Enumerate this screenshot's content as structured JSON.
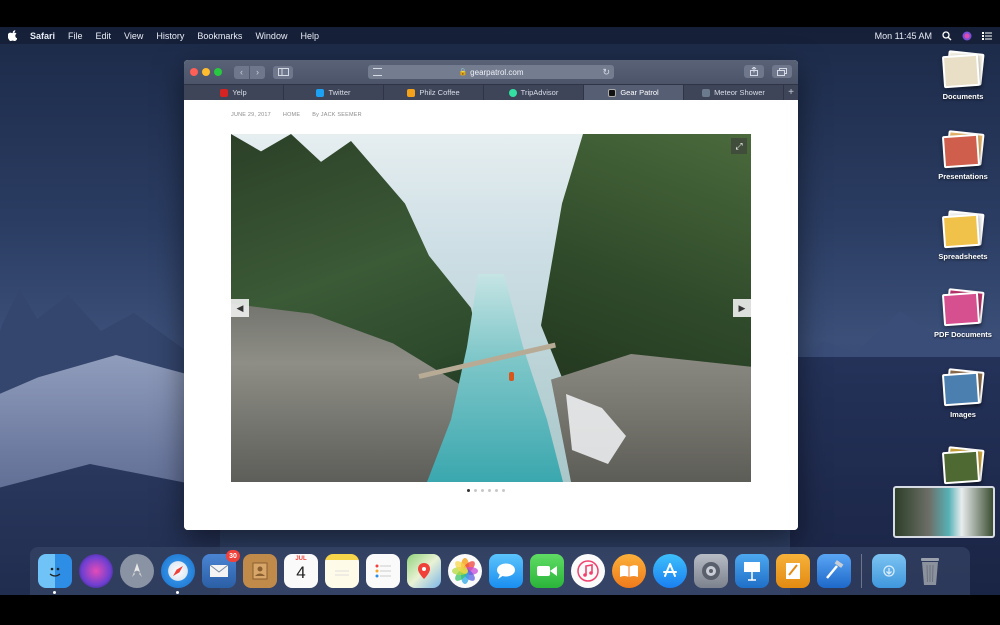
{
  "menubar": {
    "items": [
      "Safari",
      "File",
      "Edit",
      "View",
      "History",
      "Bookmarks",
      "Window",
      "Help"
    ],
    "clock": "Mon 11:45 AM"
  },
  "browser": {
    "address": "gearpatrol.com",
    "tabs": [
      {
        "label": "Yelp",
        "color": "#d32323"
      },
      {
        "label": "Twitter",
        "color": "#1da1f2"
      },
      {
        "label": "Philz Coffee",
        "color": "#f3a21a"
      },
      {
        "label": "TripAdvisor",
        "color": "#34e0a1"
      },
      {
        "label": "Gear Patrol",
        "color": "#222222"
      },
      {
        "label": "Meteor Shower",
        "color": "#6b7a8c"
      }
    ],
    "active_tab": 4
  },
  "article": {
    "date": "JUNE 29, 2017",
    "section": "HOME",
    "byline": "By JACK SEEMER",
    "slide_count": 6,
    "active_slide": 0
  },
  "stacks": [
    {
      "label": "Documents"
    },
    {
      "label": "Presentations"
    },
    {
      "label": "Spreadsheets"
    },
    {
      "label": "PDF Documents"
    },
    {
      "label": "Images"
    }
  ],
  "dock": {
    "mail_badge": "30",
    "calendar_month": "JUL",
    "calendar_day": "4"
  }
}
